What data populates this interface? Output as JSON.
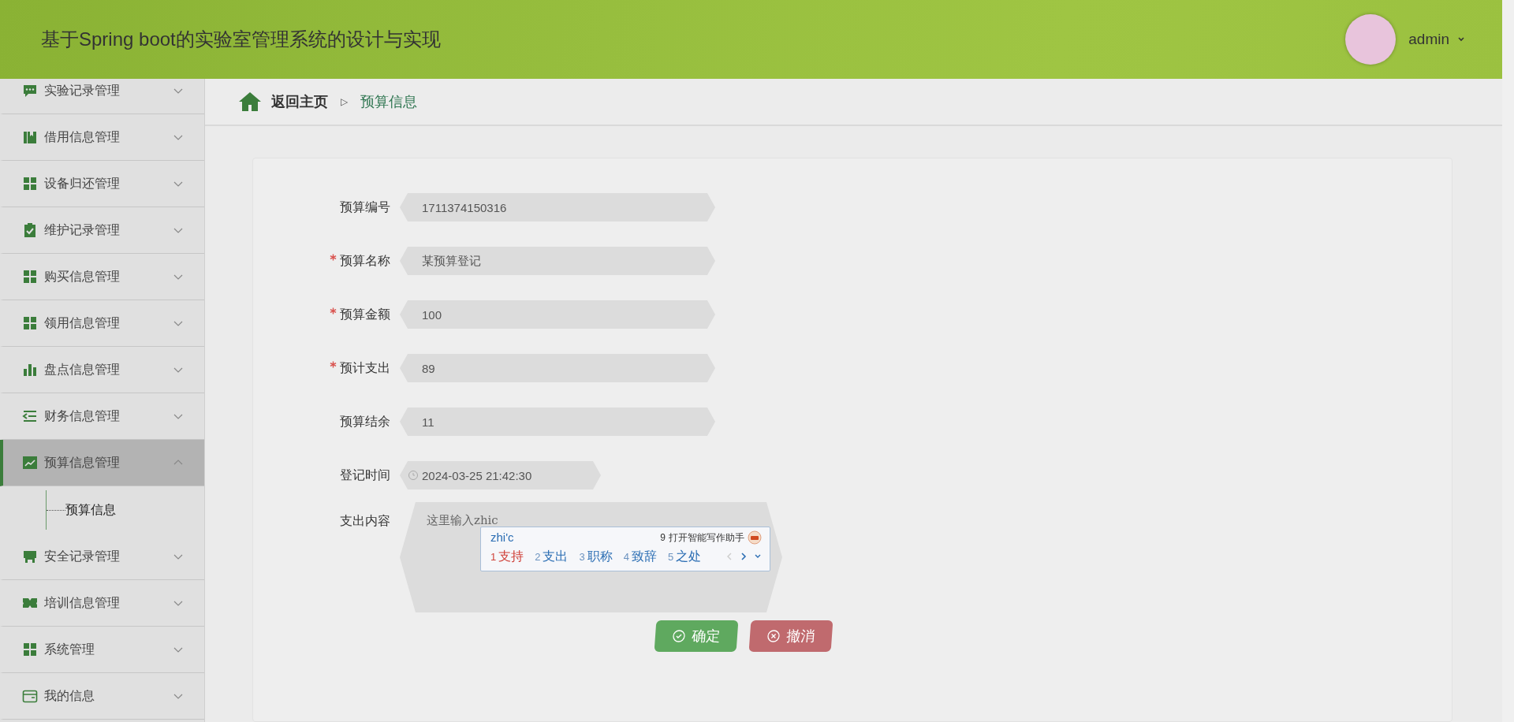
{
  "header": {
    "title": "基于Spring boot的实验室管理系统的设计与实现",
    "user": {
      "name": "admin"
    }
  },
  "sidebar": {
    "items": [
      {
        "label": "实验记录管理",
        "expanded": false,
        "selected": false
      },
      {
        "label": "借用信息管理",
        "expanded": false,
        "selected": false
      },
      {
        "label": "设备归还管理",
        "expanded": false,
        "selected": false
      },
      {
        "label": "维护记录管理",
        "expanded": false,
        "selected": false
      },
      {
        "label": "购买信息管理",
        "expanded": false,
        "selected": false
      },
      {
        "label": "领用信息管理",
        "expanded": false,
        "selected": false
      },
      {
        "label": "盘点信息管理",
        "expanded": false,
        "selected": false
      },
      {
        "label": "财务信息管理",
        "expanded": false,
        "selected": false
      },
      {
        "label": "预算信息管理",
        "expanded": true,
        "selected": true,
        "children": [
          {
            "label": "预算信息"
          }
        ]
      },
      {
        "label": "安全记录管理",
        "expanded": false,
        "selected": false
      },
      {
        "label": "培训信息管理",
        "expanded": false,
        "selected": false
      },
      {
        "label": "系统管理",
        "expanded": false,
        "selected": false
      },
      {
        "label": "我的信息",
        "expanded": false,
        "selected": false
      }
    ]
  },
  "breadcrumb": {
    "home": "返回主页",
    "separator": "▷",
    "current": "预算信息"
  },
  "form": {
    "fields": [
      {
        "kind": "text",
        "label": "预算编号",
        "required": false,
        "value": "1711374150316"
      },
      {
        "kind": "text",
        "label": "预算名称",
        "required": true,
        "value": "某预算登记"
      },
      {
        "kind": "text",
        "label": "预算金额",
        "required": true,
        "value": "100"
      },
      {
        "kind": "text",
        "label": "预计支出",
        "required": true,
        "value": "89"
      },
      {
        "kind": "text",
        "label": "预算结余",
        "required": false,
        "value": "11"
      },
      {
        "kind": "datetime",
        "label": "登记时间",
        "required": false,
        "value": "2024-03-25 21:42:30"
      },
      {
        "kind": "textarea",
        "label": "支出内容",
        "required": false,
        "value": "这里输入zhic"
      }
    ],
    "buttons": [
      {
        "kind": "confirm",
        "label": "确定"
      },
      {
        "kind": "cancel",
        "label": "撤消"
      }
    ]
  },
  "ime": {
    "composition": "zhi'c",
    "assistant_number": "9",
    "assistant": "打开智能写作助手",
    "candidates": [
      {
        "number": "1",
        "text": "支持",
        "selected": true
      },
      {
        "number": "2",
        "text": "支出",
        "selected": false
      },
      {
        "number": "3",
        "text": "职称",
        "selected": false
      },
      {
        "number": "4",
        "text": "致辞",
        "selected": false
      },
      {
        "number": "5",
        "text": "之处",
        "selected": false
      }
    ]
  }
}
